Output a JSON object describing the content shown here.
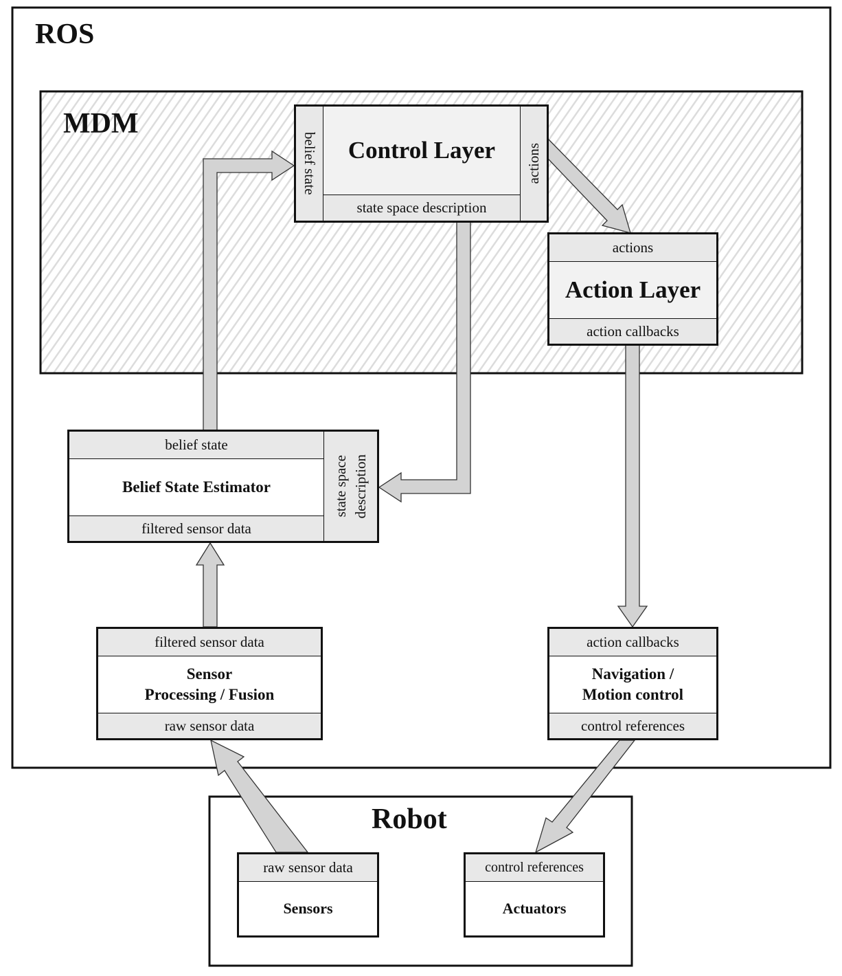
{
  "containers": {
    "ros": {
      "title": "ROS"
    },
    "mdm": {
      "title": "MDM"
    },
    "robot": {
      "title": "Robot"
    }
  },
  "blocks": {
    "control_layer": {
      "title": "Control Layer",
      "left_port": "belief state",
      "right_port": "actions",
      "bottom_port": "state space description"
    },
    "action_layer": {
      "title": "Action Layer",
      "top_port": "actions",
      "bottom_port": "action callbacks"
    },
    "belief_state_estimator": {
      "title": "Belief State Estimator",
      "top_port": "belief state",
      "bottom_port": "filtered sensor data",
      "right_port_line1": "state space",
      "right_port_line2": "description"
    },
    "sensor_processing": {
      "title_line1": "Sensor",
      "title_line2": "Processing / Fusion",
      "top_port": "filtered sensor data",
      "bottom_port": "raw sensor data"
    },
    "navigation": {
      "title_line1": "Navigation /",
      "title_line2": "Motion control",
      "top_port": "action callbacks",
      "bottom_port": "control references"
    },
    "sensors": {
      "title": "Sensors",
      "top_port": "raw sensor data"
    },
    "actuators": {
      "title": "Actuators",
      "top_port": "control references"
    }
  },
  "colors": {
    "port_fill": "#e8e8e8",
    "core_fill": "#f2f2f2",
    "arrow_fill": "#d3d3d3",
    "hatch": "#dddddd",
    "stroke": "#111111"
  }
}
